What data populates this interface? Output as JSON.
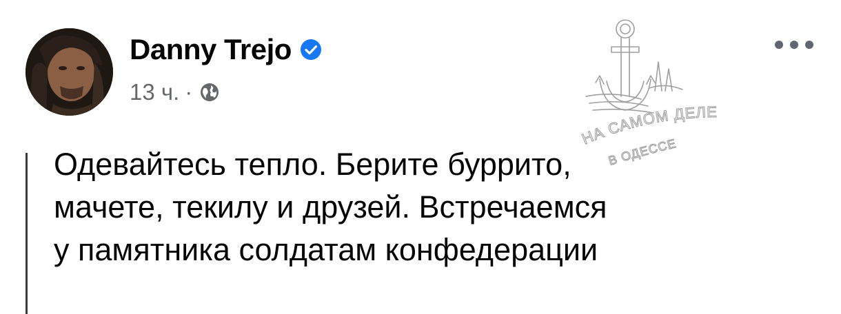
{
  "post": {
    "author": "Danny Trejo",
    "time": "13 ч.",
    "separator": "·",
    "verified_icon": "verified-badge-icon",
    "privacy_icon": "globe-icon",
    "more_icon": "more-options-icon",
    "text_lines": [
      "Одевайтесь тепло. Берите буррито,",
      "мачете, текилу и друзей. Встречаемся",
      "у памятника солдатам конфедерации"
    ]
  },
  "watermark": {
    "line1": "НА САМОМ ДЕЛЕ",
    "line2": "В ОДЕССЕ"
  },
  "colors": {
    "name": "#050505",
    "meta": "#65676b",
    "verified": "#1877f2",
    "dots": "#606770"
  }
}
